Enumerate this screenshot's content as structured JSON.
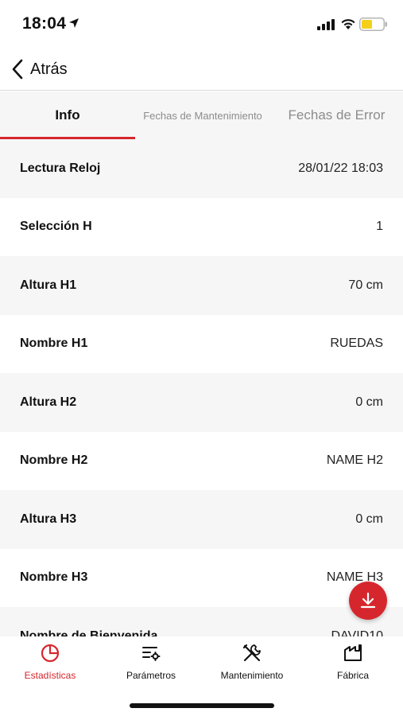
{
  "status_bar": {
    "time": "18:04"
  },
  "nav": {
    "back_label": "Atrás"
  },
  "tabs": [
    {
      "label": "Info",
      "active": true
    },
    {
      "label": "Fechas de Mantenimiento",
      "active": false
    },
    {
      "label": "Fechas de Error",
      "active": false
    }
  ],
  "rows": [
    {
      "label": "Lectura Reloj",
      "value": "28/01/22 18:03"
    },
    {
      "label": "Selección H",
      "value": "1"
    },
    {
      "label": "Altura H1",
      "value": "70 cm"
    },
    {
      "label": "Nombre H1",
      "value": "RUEDAS"
    },
    {
      "label": "Altura H2",
      "value": "0 cm"
    },
    {
      "label": "Nombre H2",
      "value": "NAME H2"
    },
    {
      "label": "Altura H3",
      "value": "0 cm"
    },
    {
      "label": "Nombre H3",
      "value": "NAME H3"
    },
    {
      "label": "Nombre de Bienvenida",
      "value": "DAVID10"
    }
  ],
  "fab": {
    "icon": "download-icon"
  },
  "bottom_nav": [
    {
      "label": "Estadísticas",
      "icon": "pie-chart-icon",
      "active": true
    },
    {
      "label": "Parámetros",
      "icon": "parameters-icon",
      "active": false
    },
    {
      "label": "Mantenimiento",
      "icon": "tools-icon",
      "active": false
    },
    {
      "label": "Fábrica",
      "icon": "factory-icon",
      "active": false
    }
  ],
  "colors": {
    "accent": "#d6262d",
    "alt_row": "#f6f6f6",
    "inactive_text": "#8c8c8c"
  }
}
